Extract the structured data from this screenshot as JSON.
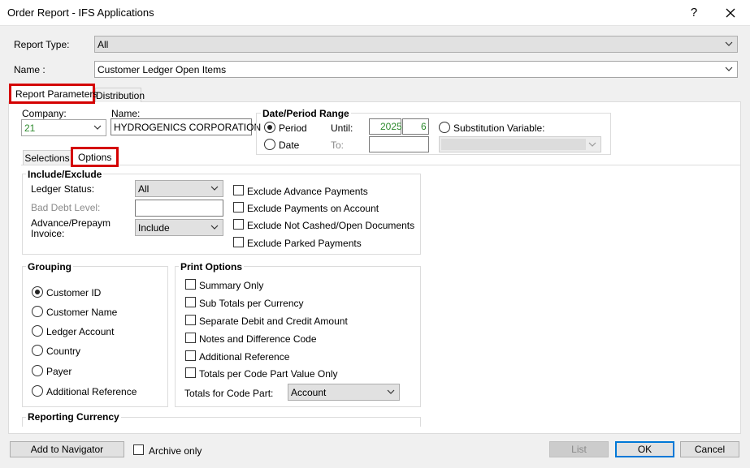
{
  "window": {
    "title": "Order Report - IFS Applications",
    "help_label": "?",
    "close_label": "✕"
  },
  "header": {
    "report_type_label": "Report Type:",
    "report_type_value": "All",
    "name_label": "Name :",
    "name_value": "Customer Ledger Open Items"
  },
  "tabs": [
    {
      "label": "Report Parameters"
    },
    {
      "label": "Distribution"
    }
  ],
  "params": {
    "company_label": "Company:",
    "company_value": "21",
    "name_label": "Name:",
    "name_value": "HYDROGENICS CORPORATION",
    "date_range": {
      "title": "Date/Period Range",
      "period_label": "Period",
      "date_label": "Date",
      "until_label": "Until:",
      "until_year": "2025",
      "until_period": "6",
      "to_label": "To:",
      "subst_label": "Substitution Variable:"
    }
  },
  "subtabs": [
    {
      "label": "Selections"
    },
    {
      "label": "Options"
    }
  ],
  "include_exclude": {
    "title": "Include/Exclude",
    "ledger_status_label": "Ledger Status:",
    "ledger_status_value": "All",
    "bad_debt_label": "Bad Debt Level:",
    "advance_label_1": "Advance/Prepaym",
    "advance_label_2": "Invoice:",
    "advance_value": "Include",
    "checks": [
      {
        "label": "Exclude Advance Payments",
        "checked": false
      },
      {
        "label": "Exclude Payments on Account",
        "checked": false
      },
      {
        "label": "Exclude Not Cashed/Open Documents",
        "checked": false
      },
      {
        "label": "Exclude Parked Payments",
        "checked": false
      }
    ]
  },
  "grouping": {
    "title": "Grouping",
    "options": [
      {
        "label": "Customer ID",
        "selected": true
      },
      {
        "label": "Customer Name",
        "selected": false
      },
      {
        "label": "Ledger Account",
        "selected": false
      },
      {
        "label": "Country",
        "selected": false
      },
      {
        "label": "Payer",
        "selected": false
      },
      {
        "label": "Additional Reference",
        "selected": false
      }
    ]
  },
  "print_options": {
    "title": "Print Options",
    "checks": [
      {
        "label": "Summary Only",
        "checked": false
      },
      {
        "label": "Sub Totals per Currency",
        "checked": false
      },
      {
        "label": "Separate Debit and Credit Amount",
        "checked": false
      },
      {
        "label": "Notes and Difference Code",
        "checked": false
      },
      {
        "label": "Additional Reference",
        "checked": false
      },
      {
        "label": "Totals per Code Part Value Only",
        "checked": false
      }
    ],
    "totals_label": "Totals for Code Part:",
    "totals_value": "Account"
  },
  "reporting_currency": {
    "title": "Reporting Currency"
  },
  "footer": {
    "add_navigator": "Add to Navigator",
    "archive_only": "Archive only",
    "list": "List",
    "ok": "OK",
    "cancel": "Cancel"
  },
  "colors": {
    "accent": "#0078d7",
    "highlight": "#d40000",
    "value_green": "#2e8b2e"
  }
}
